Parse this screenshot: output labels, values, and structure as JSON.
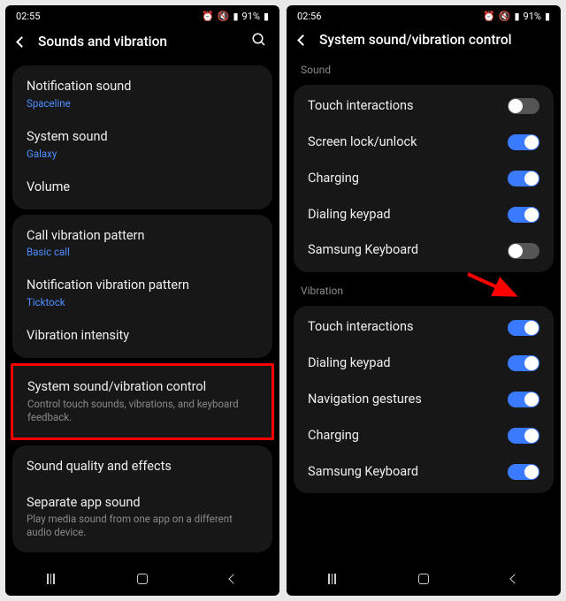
{
  "left": {
    "status": {
      "time": "02:55",
      "battery": "91%"
    },
    "title": "Sounds and vibration",
    "groups": [
      {
        "rows": [
          {
            "label": "Notification sound",
            "value": "Spaceline"
          },
          {
            "label": "System sound",
            "value": "Galaxy"
          },
          {
            "label": "Volume"
          }
        ]
      },
      {
        "rows": [
          {
            "label": "Call vibration pattern",
            "value": "Basic call"
          },
          {
            "label": "Notification vibration pattern",
            "value": "Ticktock"
          },
          {
            "label": "Vibration intensity"
          }
        ]
      },
      {
        "highlight": true,
        "rows": [
          {
            "label": "System sound/vibration control",
            "sub": "Control touch sounds, vibrations, and keyboard feedback."
          }
        ]
      },
      {
        "rows": [
          {
            "label": "Sound quality and effects"
          },
          {
            "label": "Separate app sound",
            "sub": "Play media sound from one app on a different audio device."
          }
        ]
      }
    ]
  },
  "right": {
    "status": {
      "time": "02:56",
      "battery": "91%"
    },
    "title": "System sound/vibration control",
    "groups": [
      {
        "header": "Sound",
        "rows": [
          {
            "label": "Touch interactions",
            "toggle": "off"
          },
          {
            "label": "Screen lock/unlock",
            "toggle": "on"
          },
          {
            "label": "Charging",
            "toggle": "on"
          },
          {
            "label": "Dialing keypad",
            "toggle": "on"
          },
          {
            "label": "Samsung Keyboard",
            "toggle": "off",
            "arrow": true
          }
        ]
      },
      {
        "header": "Vibration",
        "rows": [
          {
            "label": "Touch interactions",
            "toggle": "on"
          },
          {
            "label": "Dialing keypad",
            "toggle": "on"
          },
          {
            "label": "Navigation gestures",
            "toggle": "on"
          },
          {
            "label": "Charging",
            "toggle": "on"
          },
          {
            "label": "Samsung Keyboard",
            "toggle": "on"
          }
        ]
      }
    ]
  }
}
